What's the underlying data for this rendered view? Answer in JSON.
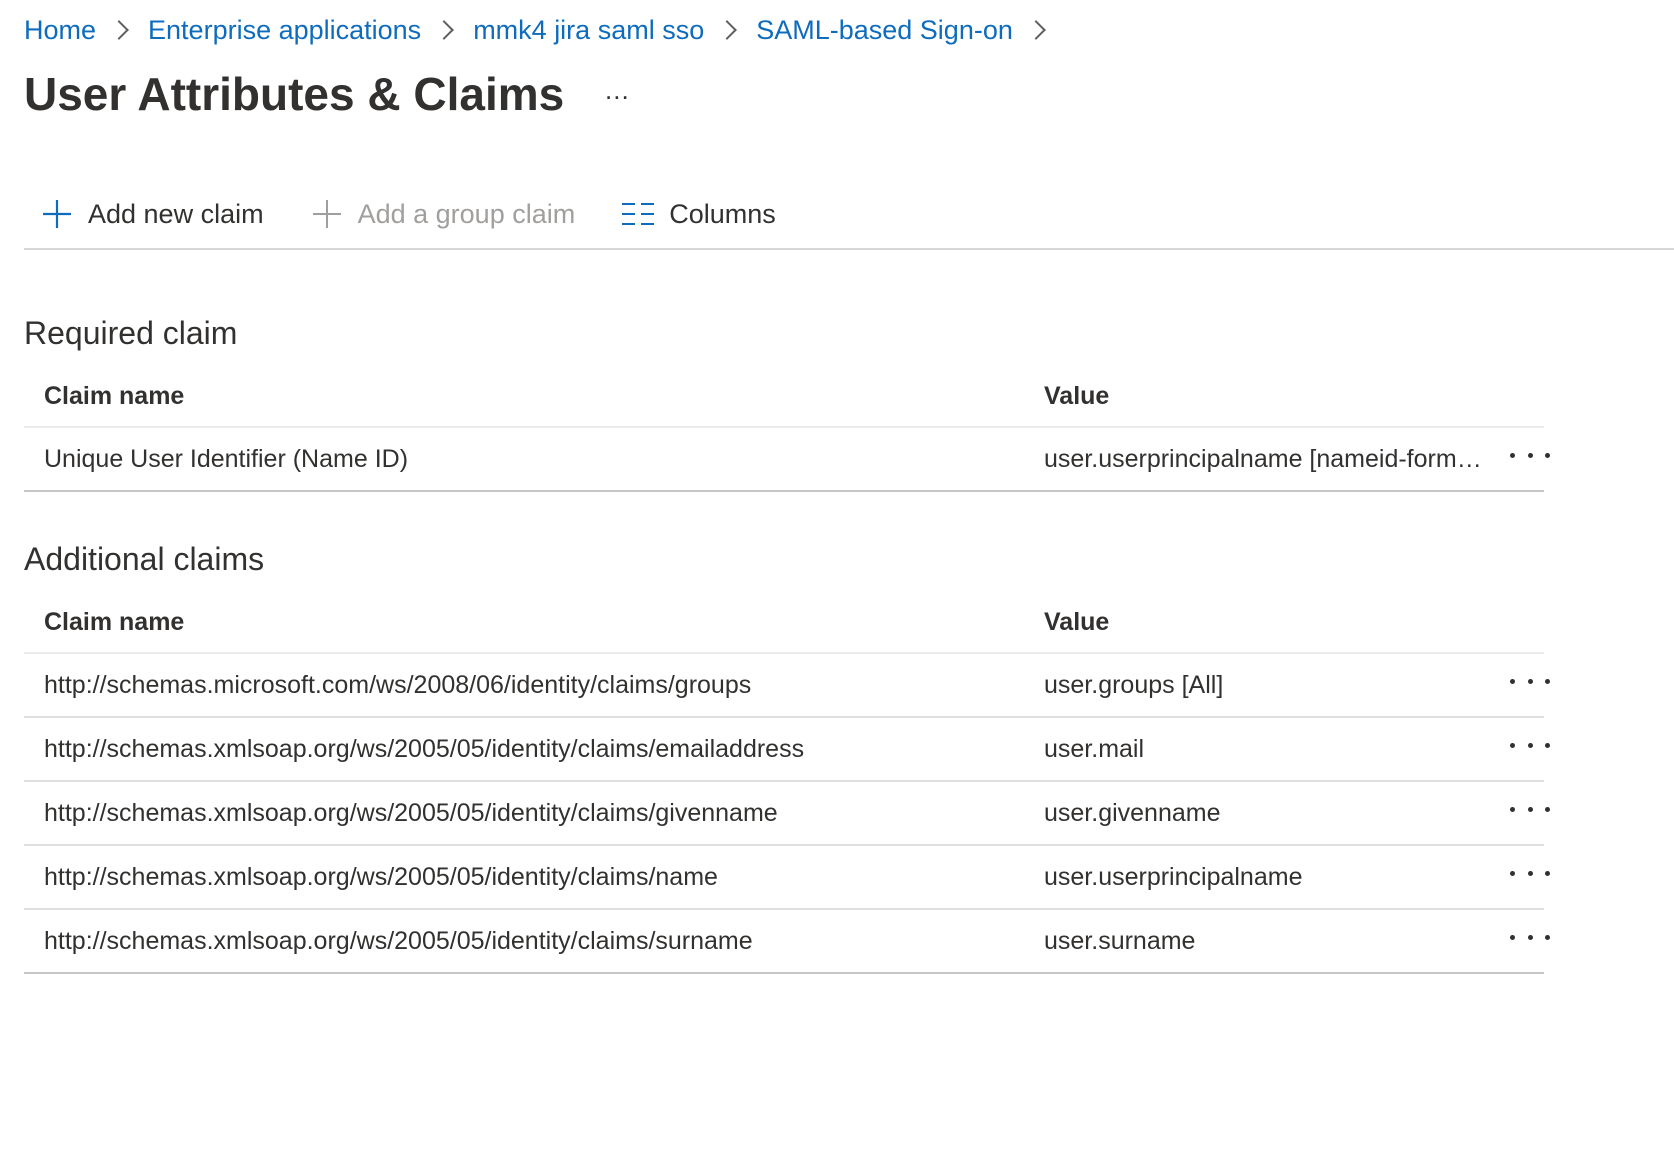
{
  "breadcrumb": {
    "items": [
      "Home",
      "Enterprise applications",
      "mmk4 jira saml sso",
      "SAML-based Sign-on"
    ]
  },
  "page": {
    "title": "User Attributes & Claims",
    "more_label": "..."
  },
  "toolbar": {
    "add_claim_label": "Add new claim",
    "add_group_claim_label": "Add a group claim",
    "columns_label": "Columns"
  },
  "required": {
    "section_title": "Required claim",
    "col_name": "Claim name",
    "col_value": "Value",
    "rows": [
      {
        "name": "Unique User Identifier (Name ID)",
        "value": "user.userprincipalname [nameid-format:emailAddress]"
      }
    ]
  },
  "additional": {
    "section_title": "Additional claims",
    "col_name": "Claim name",
    "col_value": "Value",
    "rows": [
      {
        "name": "http://schemas.microsoft.com/ws/2008/06/identity/claims/groups",
        "value": "user.groups [All]"
      },
      {
        "name": "http://schemas.xmlsoap.org/ws/2005/05/identity/claims/emailaddress",
        "value": "user.mail"
      },
      {
        "name": "http://schemas.xmlsoap.org/ws/2005/05/identity/claims/givenname",
        "value": "user.givenname"
      },
      {
        "name": "http://schemas.xmlsoap.org/ws/2005/05/identity/claims/name",
        "value": "user.userprincipalname"
      },
      {
        "name": "http://schemas.xmlsoap.org/ws/2005/05/identity/claims/surname",
        "value": "user.surname"
      }
    ]
  },
  "colors": {
    "link": "#0f6cbd",
    "text": "#323130",
    "disabled": "#a19f9d",
    "icon_accent": "#0f6cbd"
  },
  "icons": {
    "add_claim": "plus-icon",
    "add_group_claim": "plus-icon",
    "columns": "columns-icon",
    "breadcrumb_separator": "chevron-right-icon",
    "row_more": "more-icon"
  }
}
